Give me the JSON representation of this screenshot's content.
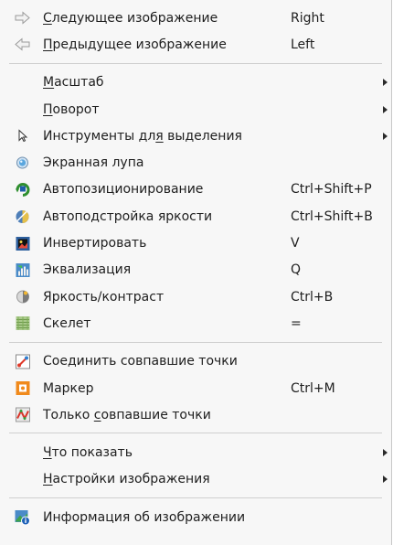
{
  "menu": {
    "items": [
      {
        "type": "item",
        "name": "next-image-item",
        "icon": "arrow-right-outline-icon",
        "label_pre": "",
        "label_ul": "С",
        "label_post": "ледующее  изображение",
        "shortcut": "Right",
        "submenu": false
      },
      {
        "type": "item",
        "name": "prev-image-item",
        "icon": "arrow-left-outline-icon",
        "label_pre": "",
        "label_ul": "П",
        "label_post": "редыдущее изображение",
        "shortcut": "Left",
        "submenu": false
      },
      {
        "type": "separator"
      },
      {
        "type": "item",
        "name": "zoom-item",
        "icon": "",
        "label_pre": "",
        "label_ul": "М",
        "label_post": "асштаб",
        "shortcut": "",
        "submenu": true
      },
      {
        "type": "item",
        "name": "rotate-item",
        "icon": "",
        "label_pre": "",
        "label_ul": "П",
        "label_post": "оворот",
        "shortcut": "",
        "submenu": true
      },
      {
        "type": "item",
        "name": "selection-tools-item",
        "icon": "cursor-icon",
        "label_pre": "Инструменты дл",
        "label_ul": "я",
        "label_post": " выделения",
        "shortcut": "",
        "submenu": true
      },
      {
        "type": "item",
        "name": "magnifier-item",
        "icon": "magnifier-icon",
        "label_pre": "Экранная лупа",
        "label_ul": "",
        "label_post": "",
        "shortcut": "",
        "submenu": false
      },
      {
        "type": "item",
        "name": "auto-position-item",
        "icon": "auto-position-icon",
        "label_pre": "Автопозиционирование",
        "label_ul": "",
        "label_post": "",
        "shortcut": "Ctrl+Shift+P",
        "submenu": false
      },
      {
        "type": "item",
        "name": "auto-brightness-item",
        "icon": "auto-brightness-icon",
        "label_pre": "Автоподстройка яркости",
        "label_ul": "",
        "label_post": "",
        "shortcut": "Ctrl+Shift+B",
        "submenu": false
      },
      {
        "type": "item",
        "name": "invert-item",
        "icon": "invert-icon",
        "label_pre": "Инвертировать",
        "label_ul": "",
        "label_post": "",
        "shortcut": "V",
        "submenu": false
      },
      {
        "type": "item",
        "name": "equalize-item",
        "icon": "equalize-icon",
        "label_pre": "Эквализация",
        "label_ul": "",
        "label_post": "",
        "shortcut": "Q",
        "submenu": false
      },
      {
        "type": "item",
        "name": "brightness-contrast-item",
        "icon": "brightness-contrast-icon",
        "label_pre": "Яркость/контраст",
        "label_ul": "",
        "label_post": "",
        "shortcut": "Ctrl+B",
        "submenu": false
      },
      {
        "type": "item",
        "name": "skeleton-item",
        "icon": "skeleton-icon",
        "label_pre": "Скелет",
        "label_ul": "",
        "label_post": "",
        "shortcut": "=",
        "submenu": false
      },
      {
        "type": "separator"
      },
      {
        "type": "item",
        "name": "connect-matched-points-item",
        "icon": "connect-points-icon",
        "label_pre": "Соединить совпавшие точки",
        "label_ul": "",
        "label_post": "",
        "shortcut": "",
        "submenu": false
      },
      {
        "type": "item",
        "name": "marker-item",
        "icon": "marker-icon",
        "label_pre": "Маркер",
        "label_ul": "",
        "label_post": "",
        "shortcut": "Ctrl+M",
        "submenu": false
      },
      {
        "type": "item",
        "name": "only-matched-points-item",
        "icon": "matched-points-icon",
        "label_pre": "Только ",
        "label_ul": "с",
        "label_post": "овпавшие точки",
        "shortcut": "",
        "submenu": false
      },
      {
        "type": "separator"
      },
      {
        "type": "item",
        "name": "what-to-show-item",
        "icon": "",
        "label_pre": "",
        "label_ul": "Ч",
        "label_post": "то показать",
        "shortcut": "",
        "submenu": true
      },
      {
        "type": "item",
        "name": "image-settings-item",
        "icon": "",
        "label_pre": "",
        "label_ul": "Н",
        "label_post": "астройки изображения",
        "shortcut": "",
        "submenu": true
      },
      {
        "type": "separator"
      },
      {
        "type": "item",
        "name": "image-info-item",
        "icon": "image-info-icon",
        "label_pre": "Информация об изображении",
        "label_ul": "",
        "label_post": "",
        "shortcut": "",
        "submenu": false
      }
    ]
  }
}
